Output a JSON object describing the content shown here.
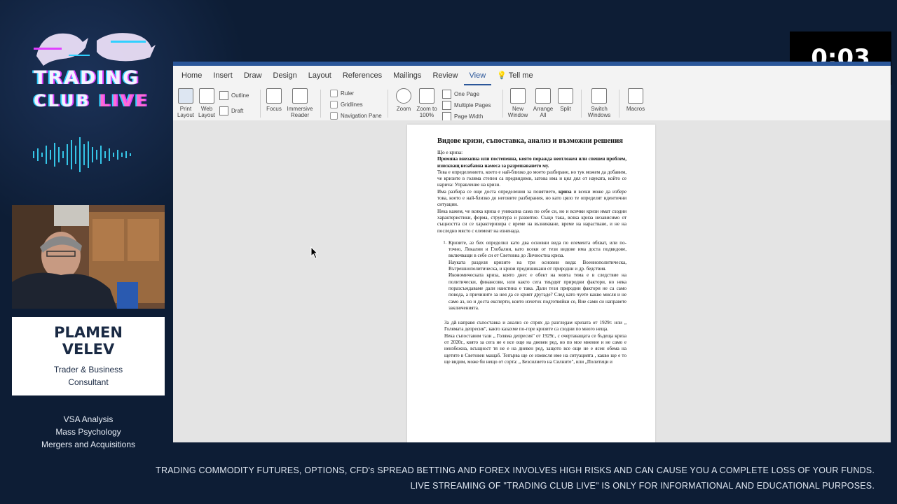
{
  "overlay": {
    "logo_line1": "TRADING",
    "logo_line2a": "CLUB",
    "logo_line2b": "LIVE",
    "presenter_name_1": "PLAMEN",
    "presenter_name_2": "VELEV",
    "presenter_role_1": "Trader & Business",
    "presenter_role_2": "Consultant",
    "skills": [
      "VSA Analysis",
      "Mass Psychology",
      "Mergers and Acquisitions"
    ],
    "timer": "0:03",
    "disclaimer_1": "TRADING COMMODITY FUTURES, OPTIONS, CFD's SPREAD BETTING AND FOREX INVOLVES HIGH RISKS AND CAN CAUSE YOU A COMPLETE LOSS OF YOUR FUNDS.",
    "disclaimer_2": "LIVE STREAMING OF \"TRADING CLUB LIVE\" IS ONLY FOR INFORMATIONAL AND EDUCATIONAL PURPOSES.",
    "brand_colors": {
      "accent_pink": "#ff6bd6",
      "accent_cyan": "#30d0ff",
      "background": "#0d1d35"
    }
  },
  "word": {
    "tabs": [
      "Home",
      "Insert",
      "Draw",
      "Design",
      "Layout",
      "References",
      "Mailings",
      "Review",
      "View"
    ],
    "active_tab": "View",
    "tell_me": "Tell me",
    "ribbon": {
      "print_layout": "Print Layout",
      "web_layout": "Web Layout",
      "outline": "Outline",
      "draft": "Draft",
      "focus": "Focus",
      "immersive_reader": "Immersive Reader",
      "ruler": "Ruler",
      "gridlines": "Gridlines",
      "navigation_pane": "Navigation Pane",
      "zoom": "Zoom",
      "zoom_100": "Zoom to 100%",
      "one_page": "One Page",
      "multiple_pages": "Multiple Pages",
      "page_width": "Page Width",
      "new_window": "New Window",
      "arrange_all": "Arrange All",
      "split": "Split",
      "switch_windows": "Switch Windows",
      "macros": "Macros"
    },
    "document": {
      "title": "Видове кризи, съпоставка, анализ и възможни решения",
      "q": "Що е криза:",
      "def_bold": "Промяна внезапна или постепенна, която поражда неотложен или спешен проблем, изискващ незабавна намеса за разрешаването му.",
      "p1": "Това е определението, което е най-близко до моето разбиране, но тук можем да добавим, че кризите в голяма степен са предвидими, затова има и цял дял от науката, който се нарича: Управление на кризи.",
      "p2a": "Има разбира се още доста определения за понятието,",
      "p2b": "криза",
      "p2c": "и всеки може да избере това, което е най-близко до неговите разбирания, но като цяло те определят идентични ситуации.",
      "p3": "Нека кажем, че всяка криза е уникална сама по себе си, но и всички кризи имат сходни характеристики, форма, структура и развитие. Също така, всяка криза независимо от същността си се характеризира с време на възникване, време на нарастване, и не на последно място с елемент на изненада.",
      "list": [
        {
          "num": "1.",
          "paras": [
            "Кризите, аз бих определил като два основни вида по елемента обхват, или по-точно, Локални и Глобални, като всеки от тези видове има доста подвидове, включващи в себе си от Световна до Личностна криза.",
            "Науката разделя кризите на три основни вида: Военнополитическа, Вътрешнополитическа, и кризи предизвикани от природни и др. бедствия.",
            "Икономическата криза, която днес е обект на моята тема е в следствие на политически, финансови, или както сега твърдят природни фактори, но нека поразсъждаваме дали наистина е така. Дали тези природни фактори не са само повода, а причините за нея да се крият другаде? След като чуете какво мисля и не само аз, но и доста експерти, които изчетох подготвяйки се, Вие сами си направете заключенията."
          ]
        },
        {
          "num": "2.",
          "paras": [
            "За да направя съпоставка и анализ се спрях да разгледам кризата от 1929г. или „ Голямата депресия\", както казахме по-горе кризите са сходни по много неща.",
            "Нека съпоставим тази „ Голяма депресия\" от 1929г., с очертаващата се бъдеща криза от 2020г., която за сега не е все още на дневен ред, но по мое мнение и не само е неизбежна, всъщност тя не е на дневен ред, защото все още не е ясен обема на щетите в Световен мащаб. Тепърва ще се измисля име на ситуацията , какво ще е то ще видим, може би нещо от сорта: „ Безсилието на Силните\", или „Политици и"
          ]
        }
      ]
    }
  }
}
